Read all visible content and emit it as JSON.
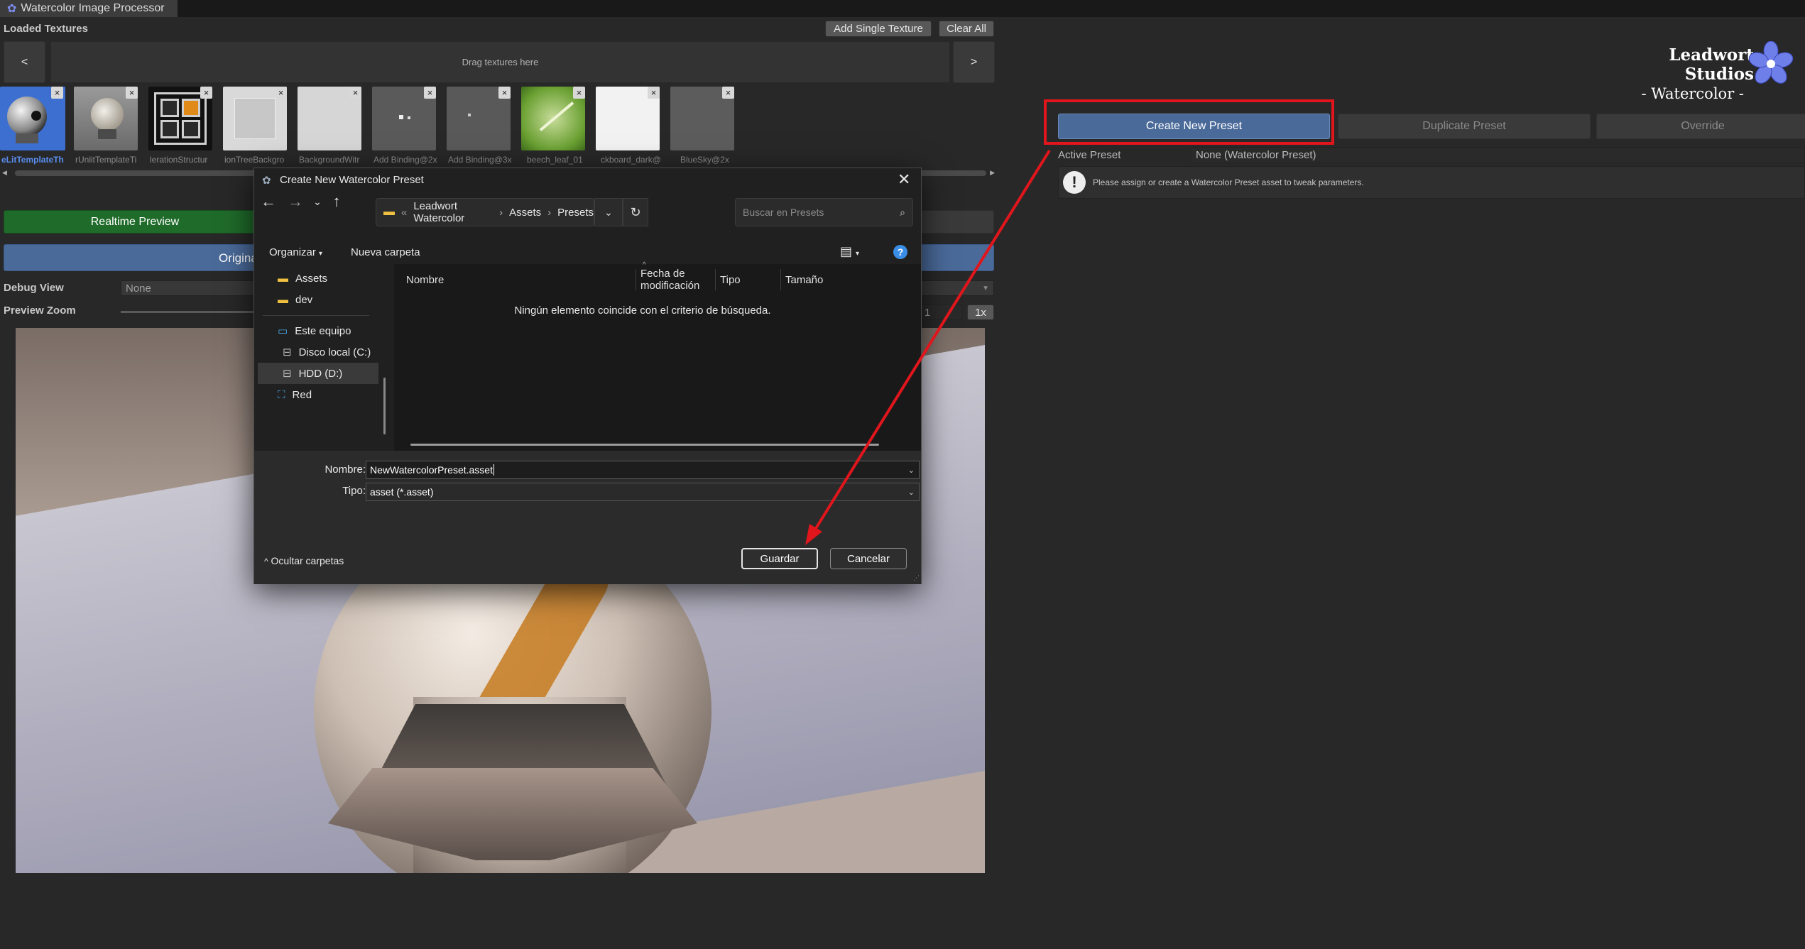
{
  "window": {
    "tab_title": "Watercolor Image Processor"
  },
  "textures": {
    "section_label": "Loaded Textures",
    "add_single": "Add Single Texture",
    "clear_all": "Clear All",
    "prev": "<",
    "next": ">",
    "drop_hint": "Drag textures here",
    "remove": "×",
    "items": [
      {
        "name": "eLitTemplateTh"
      },
      {
        "name": "rUnlitTemplateTi"
      },
      {
        "name": "lerationStructur"
      },
      {
        "name": "ionTreeBackgro"
      },
      {
        "name": "BackgroundWitr"
      },
      {
        "name": "Add Binding@2x"
      },
      {
        "name": "Add Binding@3x"
      },
      {
        "name": "beech_leaf_01"
      },
      {
        "name": "ckboard_dark@"
      },
      {
        "name": "BlueSky@2x"
      }
    ]
  },
  "preview": {
    "realtime": "Realtime Preview",
    "original": "Original",
    "debug_label": "Debug View",
    "debug_value": "None",
    "zoom_label": "Preview Zoom",
    "zoom_value": "1",
    "zoom_reset": "1x"
  },
  "brand": {
    "name": "Leadwort Studios",
    "sub": "- Watercolor -"
  },
  "preset": {
    "create": "Create New Preset",
    "duplicate": "Duplicate Preset",
    "override": "Override",
    "active_label": "Active Preset",
    "active_value": "None (Watercolor Preset)",
    "help": "Please assign or create a Watercolor Preset asset to tweak parameters."
  },
  "dialog": {
    "title": "Create New Watercolor Preset",
    "breadcrumb": [
      "Leadwort Watercolor",
      "Assets",
      "Presets"
    ],
    "search_placeholder": "Buscar en Presets",
    "organize": "Organizar",
    "new_folder": "Nueva carpeta",
    "tree": [
      {
        "label": "Assets",
        "icon": "folder-icon"
      },
      {
        "label": "dev",
        "icon": "folder-icon"
      },
      {
        "label": "Este equipo",
        "icon": "computer-icon"
      },
      {
        "label": "Disco local (C:)",
        "icon": "drive-icon"
      },
      {
        "label": "HDD (D:)",
        "icon": "drive-icon"
      },
      {
        "label": "Red",
        "icon": "network-icon"
      }
    ],
    "columns": [
      "Nombre",
      "Fecha de modificación",
      "Tipo",
      "Tamaño"
    ],
    "empty": "Ningún elemento coincide con el criterio de búsqueda.",
    "name_label": "Nombre:",
    "name_value": "NewWatercolorPreset.asset",
    "type_label": "Tipo:",
    "type_value": "asset (*.asset)",
    "hide_folders": "Ocultar carpetas",
    "save": "Guardar",
    "cancel": "Cancelar"
  },
  "colors": {
    "accent_blue": "#4a6a99",
    "green": "#1f6b2a",
    "annotation_red": "#e0161c"
  }
}
